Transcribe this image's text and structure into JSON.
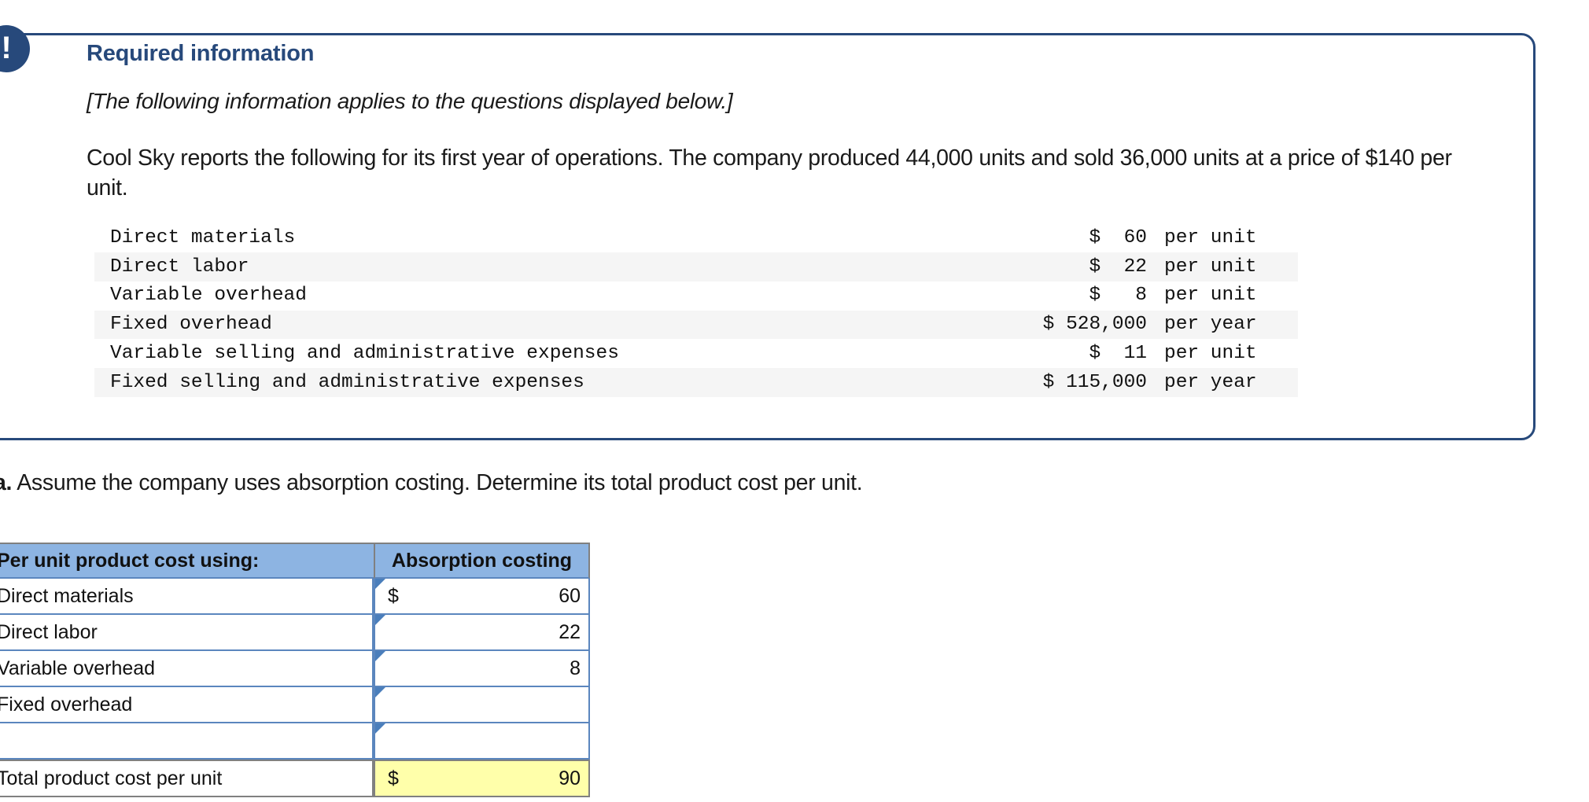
{
  "callout": {
    "badge_icon": "exclamation-icon",
    "badge_glyph": "!",
    "title": "Required information",
    "italic_note": "[The following information applies to the questions displayed below.]",
    "paragraph": "Cool Sky reports the following for its first year of operations. The company produced 44,000 units and sold 36,000 units at a price of $140 per unit.",
    "border_color": "#27497B",
    "title_color": "#27497B"
  },
  "cost_table": {
    "rows": [
      {
        "label": "Direct materials",
        "amount": "$  60",
        "period": "per unit"
      },
      {
        "label": "Direct labor",
        "amount": "$  22",
        "period": "per unit"
      },
      {
        "label": "Variable overhead",
        "amount": "$   8",
        "period": "per unit"
      },
      {
        "label": "Fixed overhead",
        "amount": "$ 528,000",
        "period": "per year"
      },
      {
        "label": "Variable selling and administrative expenses",
        "amount": "$  11",
        "period": "per unit"
      },
      {
        "label": "Fixed selling and administrative expenses",
        "amount": "$ 115,000",
        "period": "per year"
      }
    ]
  },
  "question": {
    "label": "a.",
    "text": "Assume the company uses absorption costing. Determine its total product cost per unit."
  },
  "worksheet": {
    "header": {
      "col_a": "Per unit product cost using:",
      "col_b": "Absorption costing",
      "bg_color": "#8DB4E2"
    },
    "rows": [
      {
        "label": "Direct materials",
        "dollar": "$",
        "value": "60"
      },
      {
        "label": "Direct labor",
        "dollar": "",
        "value": "22"
      },
      {
        "label": "Variable overhead",
        "dollar": "",
        "value": "8"
      },
      {
        "label": "Fixed overhead",
        "dollar": "",
        "value": ""
      },
      {
        "label": "",
        "dollar": "",
        "value": ""
      }
    ],
    "total": {
      "label": "Total product cost per unit",
      "dollar": "$",
      "value": "90",
      "bg_color": "#FFFFAA"
    }
  }
}
